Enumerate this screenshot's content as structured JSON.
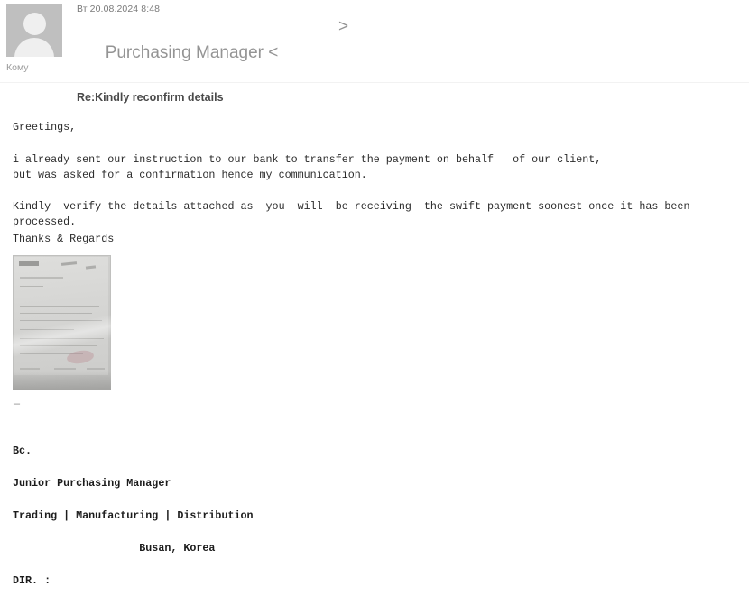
{
  "message": {
    "date_line": "Вт 20.08.2024 8:48",
    "from_name": "Purchasing Manager <",
    "from_addr_close": ">",
    "subject": "Re:Kindly reconfirm details",
    "to_label": "Кому",
    "avatar_icon": "person-placeholder-icon"
  },
  "body": {
    "greeting": "Greetings,",
    "paragraph1": "i already sent our instruction to our bank to transfer the payment on behalf   of our client,\nbut was asked for a confirmation hence my communication.",
    "paragraph2": "Kindly  verify the details attached as  you  will  be receiving  the swift payment soonest once it has been processed.",
    "closing": "Thanks & Regards",
    "attachment_alt": "scanned-document-photo"
  },
  "signature": {
    "separator": "—",
    "line1": "Bc.",
    "line2": "Junior Purchasing Manager",
    "line3": "Trading | Manufacturing | Distribution",
    "line4": "                    Busan, Korea",
    "line5": "DIR. :"
  },
  "colors": {
    "avatar_bg": "#bfbfbf",
    "from_text": "#949494",
    "subject_text": "#4a4a4a",
    "body_text": "#2b2b2b",
    "divider": "#f2f2f2"
  }
}
